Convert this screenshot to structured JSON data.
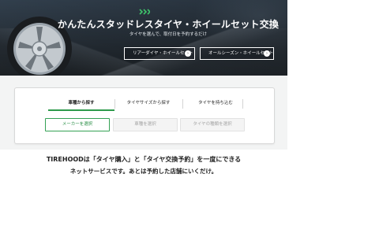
{
  "hero": {
    "title": "かんたんスタッドレスタイヤ・ホイールセット交換",
    "subtitle": "タイヤを選んで、取付日を予約するだけ",
    "buttons": {
      "rear": "リアーダイヤ・ホイールセット",
      "allseason": "オールシーズン・ホイールセット"
    },
    "arrow_glyph": "›"
  },
  "search": {
    "tabs": {
      "car": "車種から探す",
      "size": "タイヤサイズから探す",
      "owned": "タイヤを持ち込む"
    },
    "selects": {
      "maker": "メーカーを選択",
      "model": "車種を選択",
      "type": "タイヤの種類を選択"
    }
  },
  "intro": {
    "line1": "TIREHOODは「タイヤ購入」と「タイヤ交換予約」を一度にできる",
    "line2": "ネットサービスです。あとは予約した店舗にいくだけ。"
  },
  "colors": {
    "accent_green": "#2e9a4c",
    "chevron_green": "#3ec46a"
  }
}
